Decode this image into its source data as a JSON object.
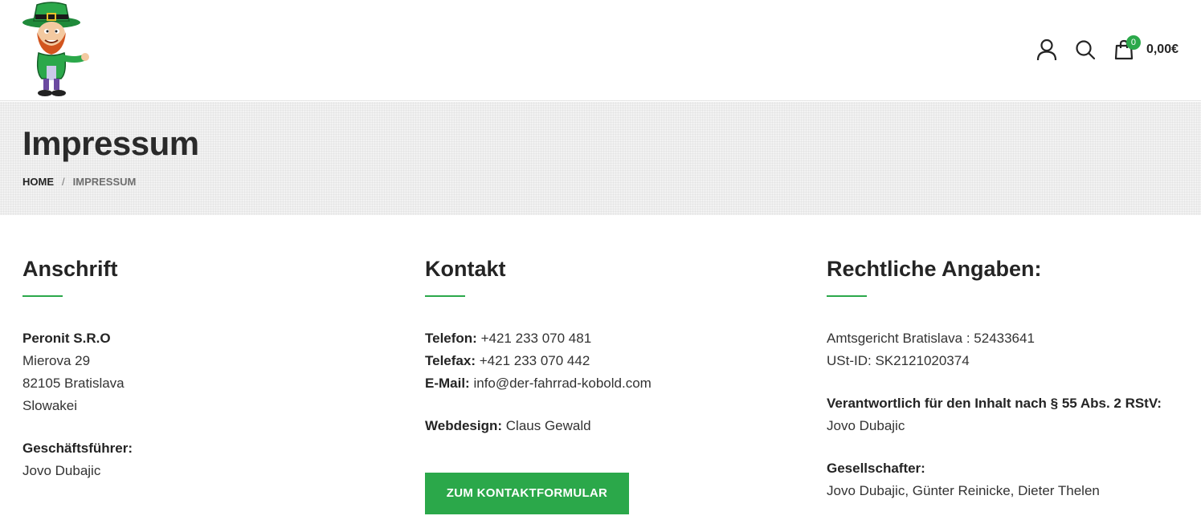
{
  "header": {
    "logo_alt": "Fahrrad-Kobold",
    "cart_count": "0",
    "cart_total": "0,00€",
    "icons": [
      "user-account-icon",
      "search-icon",
      "shopping-bag-icon"
    ]
  },
  "page": {
    "title": "Impressum",
    "breadcrumb": {
      "home": "Home",
      "separator": "/",
      "current": "Impressum"
    }
  },
  "anschrift": {
    "title": "Anschrift",
    "company": "Peronit S.R.O",
    "street": "Mierova 29",
    "city": "82105 Bratislava",
    "country": "Slowakei",
    "manager_label": "Geschäftsführer:",
    "manager": "Jovo Dubajic"
  },
  "kontakt": {
    "title": "Kontakt",
    "phone_label": "Telefon:",
    "phone": "+421 233 070 481",
    "fax_label": "Telefax:",
    "fax": "+421 233 070 442",
    "email_label": "E-Mail:",
    "email": "info@der-fahrrad-kobold.com",
    "webdesign_label": "Webdesign:",
    "webdesign": "Claus Gewald",
    "button_label": "Zum Kontaktformular"
  },
  "rechtlich": {
    "title": "Rechtliche Angaben:",
    "court": "Amtsgericht Bratislava : 52433641",
    "vat": "USt-ID: SK2121020374",
    "responsible_label": "Verantwortlich für den Inhalt nach § 55 Abs. 2 RStV:",
    "responsible": "Jovo Dubajic",
    "partners_label": "Gesellschafter:",
    "partners": "Jovo Dubajic, Günter Reinicke, Dieter Thelen"
  },
  "colors": {
    "accent": "#2ba84a",
    "text": "#242424",
    "band": "#f2f2f2"
  }
}
